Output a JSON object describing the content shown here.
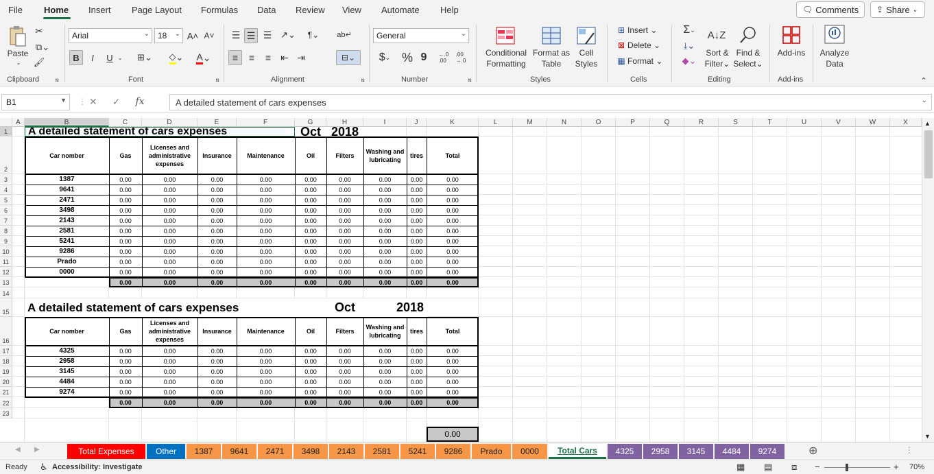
{
  "menu": {
    "items": [
      "File",
      "Home",
      "Insert",
      "Page Layout",
      "Formulas",
      "Data",
      "Review",
      "View",
      "Automate",
      "Help"
    ],
    "comments": "Comments",
    "share": "Share"
  },
  "ribbon": {
    "clipboard": {
      "paste": "Paste",
      "label": "Clipboard"
    },
    "font": {
      "name": "Arial",
      "size": "18",
      "label": "Font",
      "bold": "B",
      "italic": "I",
      "underline": "U"
    },
    "alignment": {
      "label": "Alignment"
    },
    "number": {
      "format": "General",
      "label": "Number",
      "currency": "$",
      "percent": "%",
      "comma": "9"
    },
    "styles": {
      "conditional": [
        "Conditional",
        "Formatting"
      ],
      "format_table": [
        "Format as",
        "Table"
      ],
      "cell_styles": [
        "Cell",
        "Styles"
      ],
      "label": "Styles"
    },
    "cells": {
      "insert": "Insert",
      "delete": "Delete",
      "format": "Format",
      "label": "Cells"
    },
    "editing": {
      "sum": "Σ",
      "sort": [
        "Sort &",
        "Filter"
      ],
      "find": [
        "Find &",
        "Select"
      ],
      "label": "Editing"
    },
    "addins": {
      "btn": "Add-ins",
      "label": "Add-ins"
    },
    "analyze": {
      "btn": [
        "Analyze",
        "Data"
      ]
    }
  },
  "formula": {
    "namebox": "B1",
    "fx": "fx",
    "content": "A detailed statement of cars expenses"
  },
  "columns": [
    "A",
    "B",
    "C",
    "D",
    "E",
    "F",
    "G",
    "H",
    "I",
    "J",
    "K",
    "L",
    "M",
    "N",
    "O",
    "P",
    "Q",
    "R",
    "S",
    "T",
    "U",
    "V",
    "W",
    "X"
  ],
  "rows": [
    "1",
    "2",
    "3",
    "4",
    "5",
    "6",
    "7",
    "8",
    "9",
    "10",
    "11",
    "12",
    "13",
    "14",
    "15",
    "16",
    "17",
    "18",
    "19",
    "20",
    "21",
    "22",
    "23"
  ],
  "table1": {
    "title": "A detailed statement of cars expenses",
    "month": "Oct",
    "year": "2018",
    "headers": [
      "Car nomber",
      "Gas",
      "Licenses and administrative expenses",
      "Insurance",
      "Maintenance",
      "Oil",
      "Filters",
      "Washing and lubricating",
      "tires",
      "Total"
    ],
    "cars": [
      "1387",
      "9641",
      "2471",
      "3498",
      "2143",
      "2581",
      "5241",
      "9286",
      "Prado",
      "0000"
    ],
    "value": "0.00"
  },
  "table2": {
    "title": "A detailed statement of cars expenses",
    "month": "Oct",
    "year": "2018",
    "headers": [
      "Car nomber",
      "Gas",
      "Licenses and administrative expenses",
      "Insurance",
      "Maintenance",
      "Oil",
      "Filters",
      "Washing and lubricating",
      "tires",
      "Total"
    ],
    "cars": [
      "4325",
      "2958",
      "3145",
      "4484",
      "9274"
    ],
    "value": "0.00"
  },
  "grand_total": "0.00",
  "tabs": [
    {
      "label": "Total Expenses",
      "bg": "#ff0000",
      "fg": "#ffffff"
    },
    {
      "label": "Other",
      "bg": "#0070c0",
      "fg": "#ffffff"
    },
    {
      "label": "1387",
      "bg": "#f79646",
      "fg": "#222222"
    },
    {
      "label": "9641",
      "bg": "#f79646",
      "fg": "#222222"
    },
    {
      "label": "2471",
      "bg": "#f79646",
      "fg": "#222222"
    },
    {
      "label": "3498",
      "bg": "#f79646",
      "fg": "#222222"
    },
    {
      "label": "2143",
      "bg": "#f79646",
      "fg": "#222222"
    },
    {
      "label": "2581",
      "bg": "#f79646",
      "fg": "#222222"
    },
    {
      "label": "5241",
      "bg": "#f79646",
      "fg": "#222222"
    },
    {
      "label": "9286",
      "bg": "#f79646",
      "fg": "#222222"
    },
    {
      "label": "Prado",
      "bg": "#f79646",
      "fg": "#222222"
    },
    {
      "label": "0000",
      "bg": "#f79646",
      "fg": "#222222"
    },
    {
      "label": "Total Cars",
      "bg": "#ffffff",
      "fg": "#1e7145"
    },
    {
      "label": "4325",
      "bg": "#8064a2",
      "fg": "#ffffff"
    },
    {
      "label": "2958",
      "bg": "#8064a2",
      "fg": "#ffffff"
    },
    {
      "label": "3145",
      "bg": "#8064a2",
      "fg": "#ffffff"
    },
    {
      "label": "4484",
      "bg": "#8064a2",
      "fg": "#ffffff"
    },
    {
      "label": "9274",
      "bg": "#8064a2",
      "fg": "#ffffff"
    }
  ],
  "status": {
    "ready": "Ready",
    "accessibility": "Accessibility: Investigate",
    "zoom": "70%"
  }
}
